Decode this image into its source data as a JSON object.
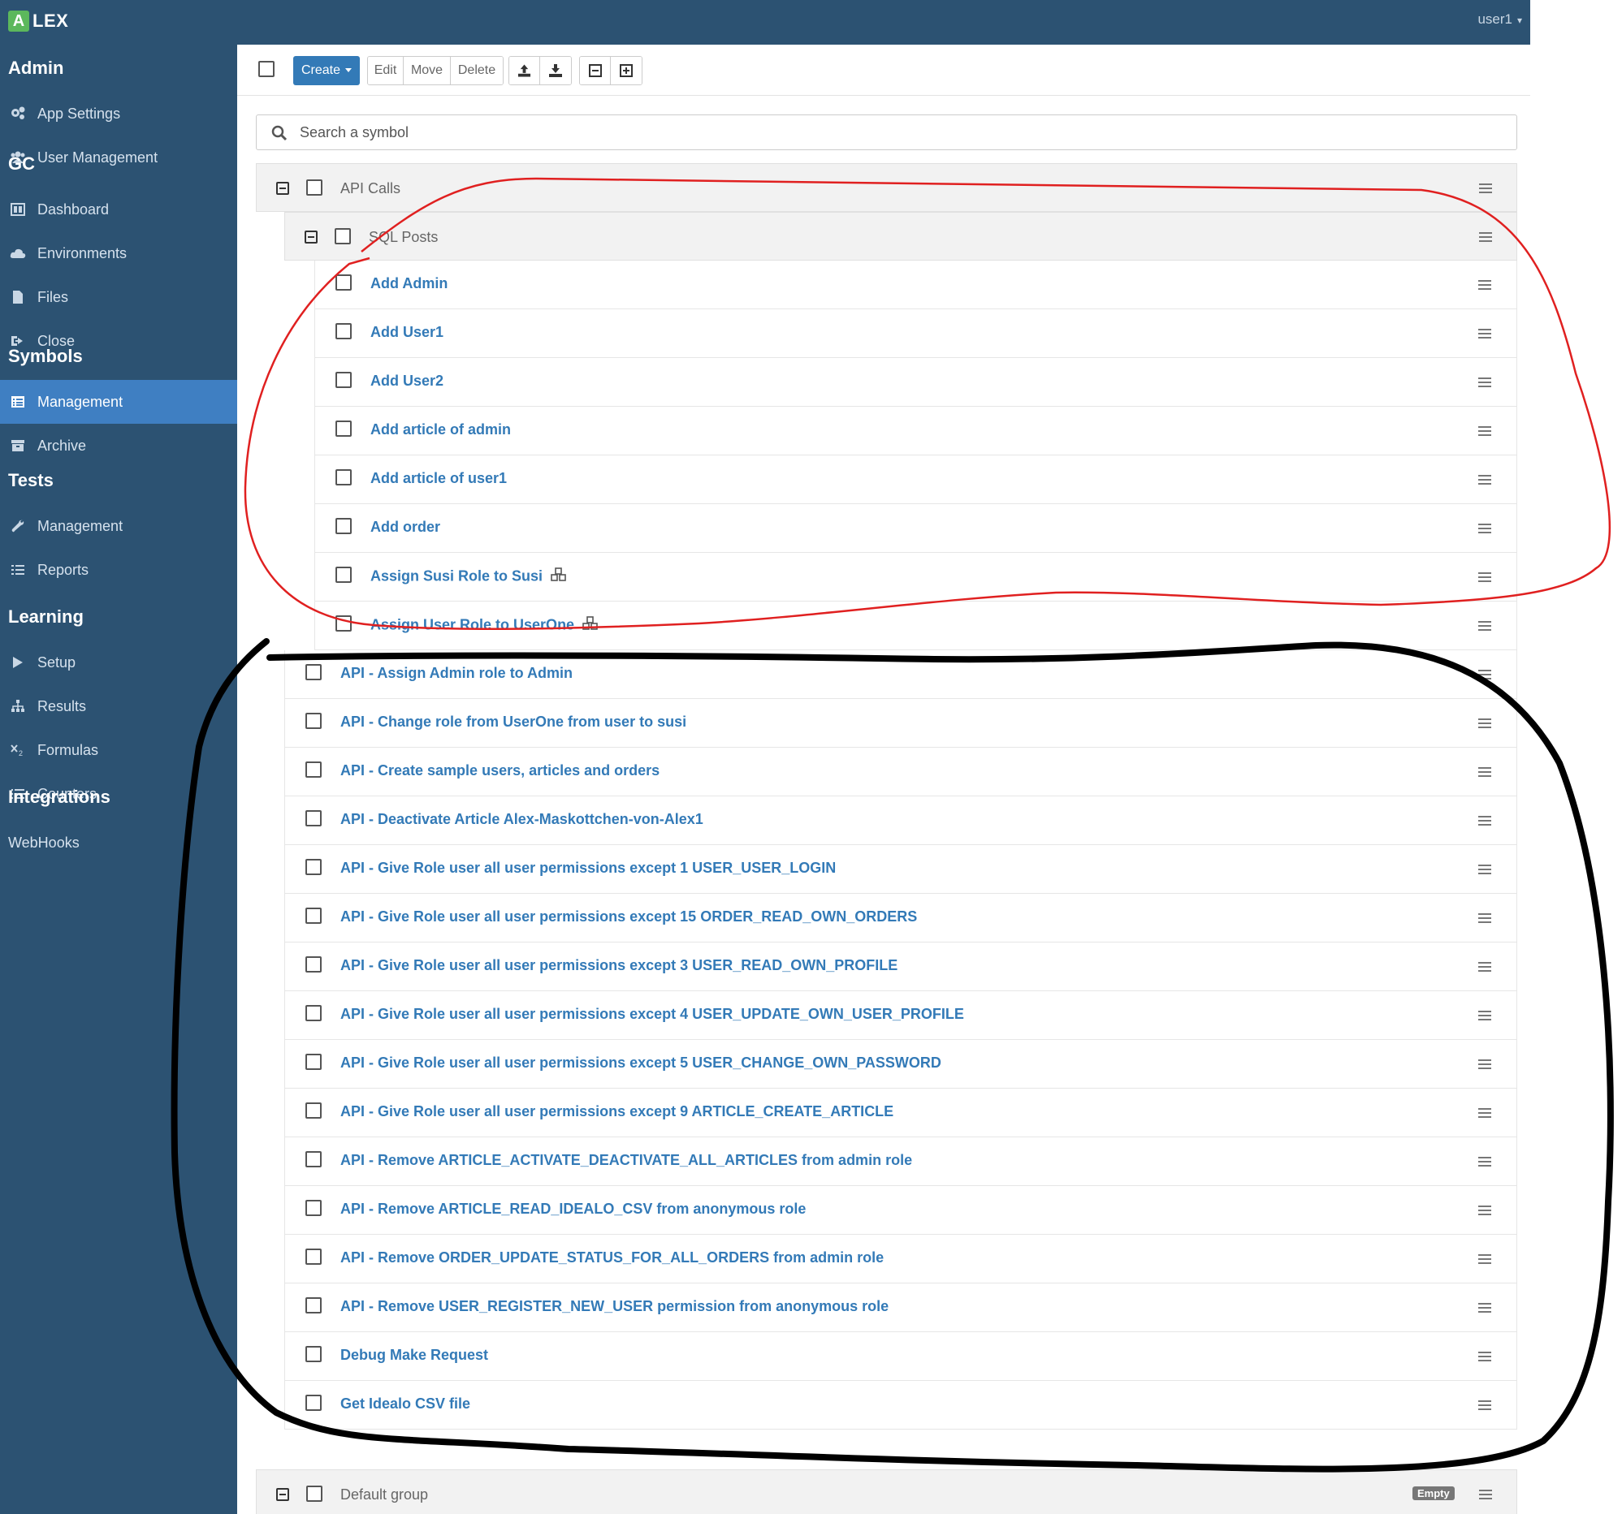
{
  "navbar": {
    "brand_badge": "A",
    "brand_text": "LEX",
    "user": "user1"
  },
  "sidebar": {
    "sections": [
      {
        "title": "Admin",
        "items": [
          {
            "label": "App Settings",
            "icon": "gears-icon"
          },
          {
            "label": "User Management",
            "icon": "users-icon"
          }
        ]
      },
      {
        "title": "GC",
        "items": [
          {
            "label": "Dashboard",
            "icon": "dashboard-icon"
          },
          {
            "label": "Environments",
            "icon": "cloud-icon"
          },
          {
            "label": "Files",
            "icon": "file-icon"
          },
          {
            "label": "Close",
            "icon": "sign-out-icon"
          }
        ]
      },
      {
        "title": "Symbols",
        "items": [
          {
            "label": "Management",
            "icon": "list-alt-icon",
            "active": true
          },
          {
            "label": "Archive",
            "icon": "archive-icon"
          }
        ]
      },
      {
        "title": "Tests",
        "items": [
          {
            "label": "Management",
            "icon": "wrench-icon"
          },
          {
            "label": "Reports",
            "icon": "list-icon"
          }
        ]
      },
      {
        "title": "Learning",
        "items": [
          {
            "label": "Setup",
            "icon": "play-icon"
          },
          {
            "label": "Results",
            "icon": "sitemap-icon"
          },
          {
            "label": "Formulas",
            "icon": "subscript-icon"
          },
          {
            "label": "Counters",
            "icon": "list-ol-icon"
          }
        ]
      },
      {
        "title": "Integrations",
        "items": [
          {
            "label": "WebHooks",
            "icon": ""
          }
        ]
      }
    ]
  },
  "toolbar": {
    "create_label": "Create",
    "edit_label": "Edit",
    "move_label": "Move",
    "delete_label": "Delete",
    "import_icon": "upload-icon",
    "export_icon": "download-icon",
    "collapse_all_icon": "minus-square-icon",
    "expand_all_icon": "plus-square-icon"
  },
  "search": {
    "placeholder": "Search a symbol"
  },
  "tree": {
    "group_api_calls": "API Calls",
    "group_sql_posts": "SQL Posts",
    "sql_posts_symbols": [
      {
        "label": "Add Admin"
      },
      {
        "label": "Add User1"
      },
      {
        "label": "Add User2"
      },
      {
        "label": "Add article of admin"
      },
      {
        "label": "Add article of user1"
      },
      {
        "label": "Add order"
      },
      {
        "label": "Assign Susi Role to Susi",
        "dependency_icon": "cubes-icon"
      },
      {
        "label": "Assign User Role to UserOne",
        "dependency_icon": "cubes-icon"
      }
    ],
    "api_calls_symbols": [
      "API - Assign Admin role to Admin",
      "API - Change role from UserOne from user to susi",
      "API - Create sample users, articles and orders",
      "API - Deactivate Article Alex-Maskottchen-von-Alex1",
      "API - Give Role user all user permissions except 1 USER_USER_LOGIN",
      "API - Give Role user all user permissions except 15 ORDER_READ_OWN_ORDERS",
      "API - Give Role user all user permissions except 3 USER_READ_OWN_PROFILE",
      "API - Give Role user all user permissions except 4 USER_UPDATE_OWN_USER_PROFILE",
      "API - Give Role user all user permissions except 5 USER_CHANGE_OWN_PASSWORD",
      "API - Give Role user all user permissions except 9 ARTICLE_CREATE_ARTICLE",
      "API - Remove ARTICLE_ACTIVATE_DEACTIVATE_ALL_ARTICLES from admin role",
      "API - Remove ARTICLE_READ_IDEALO_CSV from anonymous role",
      "API - Remove ORDER_UPDATE_STATUS_FOR_ALL_ORDERS from admin role",
      "API - Remove USER_REGISTER_NEW_USER permission from anonymous role",
      "Debug Make Request",
      "Get Idealo CSV file"
    ],
    "group_default": "Default group",
    "default_badge": "Empty"
  },
  "colors": {
    "navbar": "#2c5272",
    "sidebar_active": "#3f7fc2",
    "link": "#337ab7",
    "annotation_red": "#e02020",
    "annotation_black": "#000000"
  }
}
